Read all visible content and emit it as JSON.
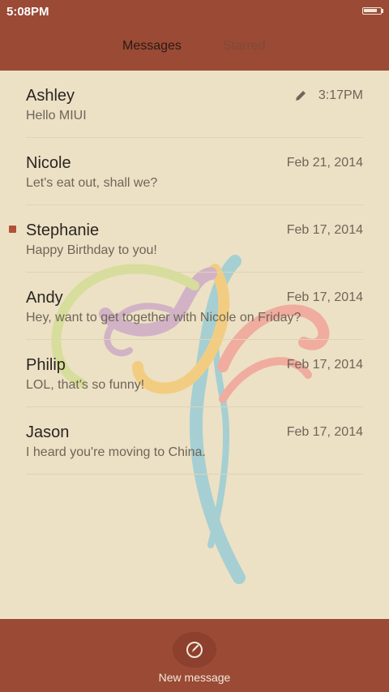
{
  "status_bar": {
    "time": "5:08PM",
    "battery_level_pct": 85
  },
  "tabs": [
    {
      "label": "Messages",
      "selected": true
    },
    {
      "label": "Starred",
      "selected": false
    }
  ],
  "conversations": [
    {
      "name": "Ashley",
      "preview": "Hello MIUI",
      "date": "3:17PM",
      "draft": true,
      "unread": false
    },
    {
      "name": "Nicole",
      "preview": "Let's eat out, shall we?",
      "date": "Feb 21, 2014",
      "draft": false,
      "unread": false
    },
    {
      "name": "Stephanie",
      "preview": "Happy Birthday to you!",
      "date": "Feb 17, 2014",
      "draft": false,
      "unread": true
    },
    {
      "name": "Andy",
      "preview": "Hey, want to get together with Nicole on Friday?",
      "date": "Feb 17, 2014",
      "draft": false,
      "unread": false
    },
    {
      "name": "Philip",
      "preview": "LOL, that's so funny!",
      "date": "Feb 17, 2014",
      "draft": false,
      "unread": false
    },
    {
      "name": "Jason",
      "preview": "I heard you're moving to China.",
      "date": "Feb 17, 2014",
      "draft": false,
      "unread": false
    }
  ],
  "bottom_bar": {
    "compose_label": "New message"
  },
  "colors": {
    "accent": "#9a4a35",
    "background": "#ece1c5",
    "unread": "#b3503a"
  }
}
